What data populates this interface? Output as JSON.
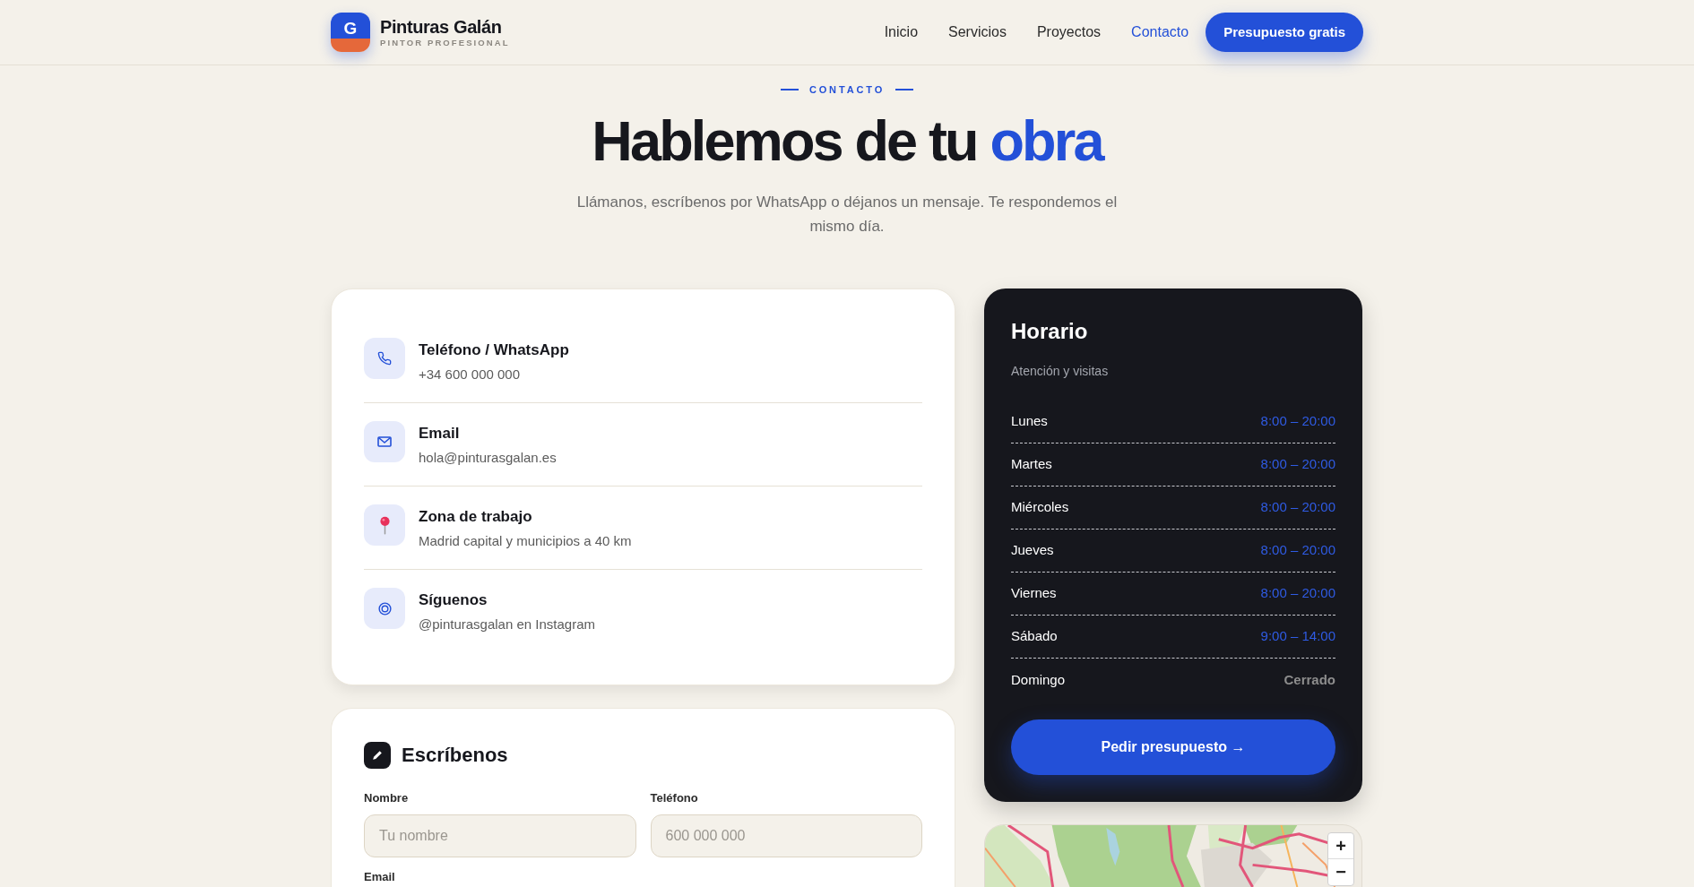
{
  "header": {
    "logo_letter": "G",
    "brand": "Pinturas Galán",
    "tagline": "PINTOR PROFESIONAL",
    "nav": [
      {
        "label": "Inicio",
        "selected": false
      },
      {
        "label": "Servicios",
        "selected": false
      },
      {
        "label": "Proyectos",
        "selected": false
      },
      {
        "label": "Contacto",
        "selected": true
      }
    ],
    "cta": "Presupuesto gratis"
  },
  "intro": {
    "eyebrow": "CONTACTO",
    "heading": "Hablemos de tu",
    "heading_highlight": "obra",
    "text": "Llámanos, escríbenos por WhatsApp o déjanos un mensaje. Te respondemos el mismo día."
  },
  "contact_card": {
    "items": [
      {
        "kind": "phone",
        "title": "Teléfono / WhatsApp",
        "value": "+34 600 000 000"
      },
      {
        "kind": "email",
        "title": "Email",
        "value": "hola@pinturasgalan.es"
      },
      {
        "kind": "location",
        "title": "Zona de trabajo",
        "value": "Madrid capital y municipios a 40 km"
      },
      {
        "kind": "social",
        "title": "Síguenos",
        "value": "@pinturasgalan en Instagram"
      }
    ]
  },
  "form": {
    "title": "Escríbenos",
    "fields": [
      {
        "label": "Nombre",
        "placeholder": "Tu nombre"
      },
      {
        "label": "Teléfono",
        "placeholder": "600 000 000"
      },
      {
        "label": "Email"
      }
    ]
  },
  "schedule": {
    "title": "Horario",
    "subtitle": "Atención y visitas",
    "rows": [
      {
        "day": "Lunes",
        "hours": "8:00 – 20:00",
        "closed": false
      },
      {
        "day": "Martes",
        "hours": "8:00 – 20:00",
        "closed": false
      },
      {
        "day": "Miércoles",
        "hours": "8:00 – 20:00",
        "closed": false
      },
      {
        "day": "Jueves",
        "hours": "8:00 – 20:00",
        "closed": false
      },
      {
        "day": "Viernes",
        "hours": "8:00 – 20:00",
        "closed": false
      },
      {
        "day": "Sábado",
        "hours": "9:00 – 14:00",
        "closed": false
      },
      {
        "day": "Domingo",
        "hours": "Cerrado",
        "closed": true
      }
    ],
    "button": "Pedir presupuesto →"
  },
  "map": {
    "zoom_in": "+",
    "zoom_out": "−"
  }
}
